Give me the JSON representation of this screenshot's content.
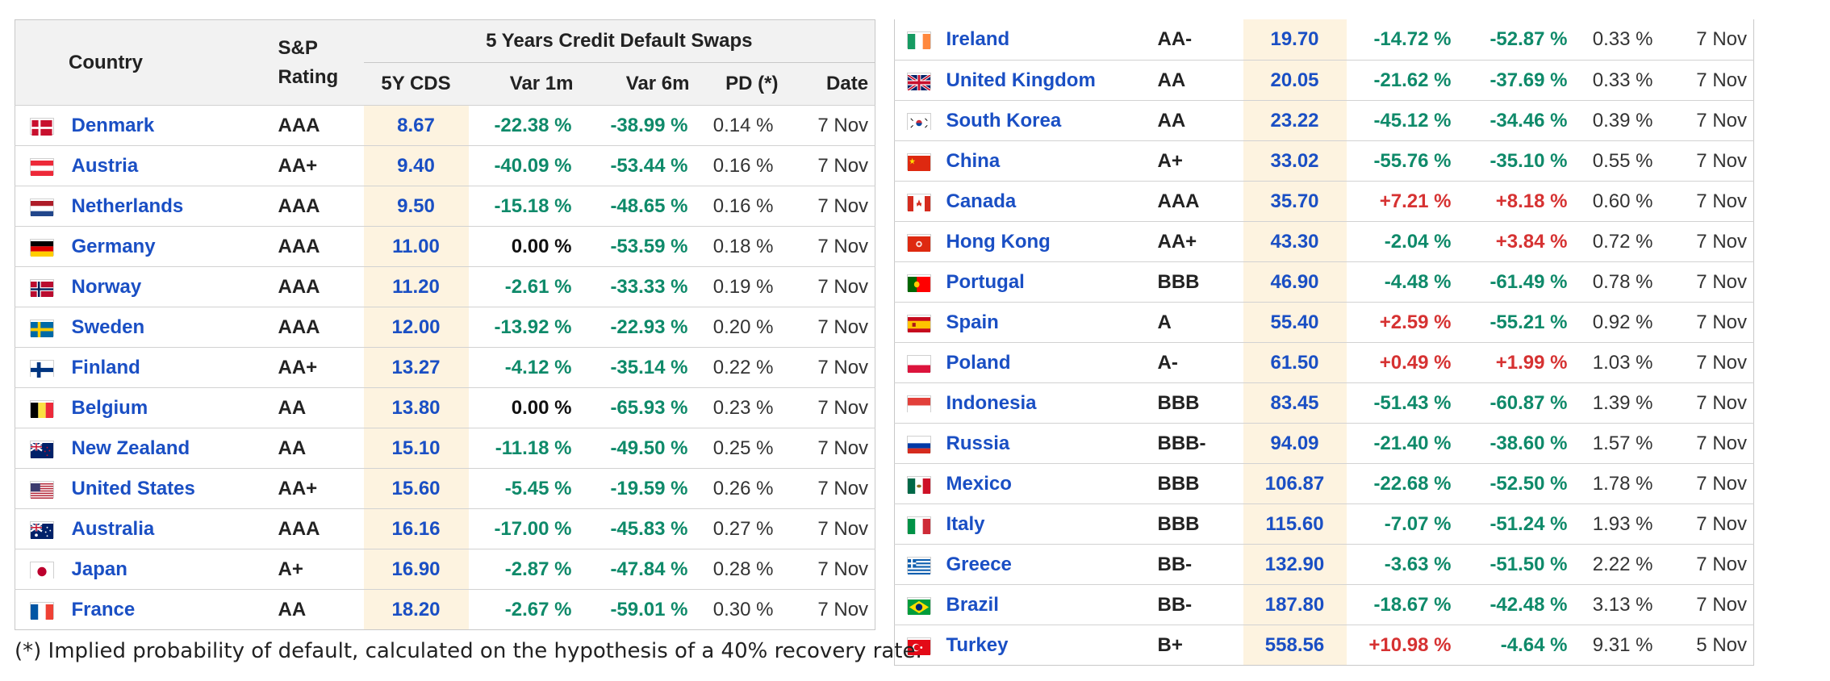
{
  "headers": {
    "country": "Country",
    "rating_line1": "S&P",
    "rating_line2": "Rating",
    "group": "5 Years Credit Default Swaps",
    "cds": "5Y CDS",
    "var1m": "Var 1m",
    "var6m": "Var 6m",
    "pd": "PD (*)",
    "date": "Date"
  },
  "footnote": "(*) Implied probability of default, calculated on the hypothesis of a 40% recovery rate.",
  "colors": {
    "negative": "#0f8a6a",
    "positive": "#d63232",
    "link": "#1a4fc4",
    "cds_bg": "#fdf3e0"
  },
  "left_rows": [
    {
      "flag": "denmark-flag-icon",
      "country": "Denmark",
      "rating": "AAA",
      "cds": "8.67",
      "var1m": "-22.38 %",
      "var6m": "-38.99 %",
      "pd": "0.14 %",
      "date": "7 Nov"
    },
    {
      "flag": "austria-flag-icon",
      "country": "Austria",
      "rating": "AA+",
      "cds": "9.40",
      "var1m": "-40.09 %",
      "var6m": "-53.44 %",
      "pd": "0.16 %",
      "date": "7 Nov"
    },
    {
      "flag": "netherlands-flag-icon",
      "country": "Netherlands",
      "rating": "AAA",
      "cds": "9.50",
      "var1m": "-15.18 %",
      "var6m": "-48.65 %",
      "pd": "0.16 %",
      "date": "7 Nov"
    },
    {
      "flag": "germany-flag-icon",
      "country": "Germany",
      "rating": "AAA",
      "cds": "11.00",
      "var1m": "0.00 %",
      "var6m": "-53.59 %",
      "pd": "0.18 %",
      "date": "7 Nov"
    },
    {
      "flag": "norway-flag-icon",
      "country": "Norway",
      "rating": "AAA",
      "cds": "11.20",
      "var1m": "-2.61 %",
      "var6m": "-33.33 %",
      "pd": "0.19 %",
      "date": "7 Nov"
    },
    {
      "flag": "sweden-flag-icon",
      "country": "Sweden",
      "rating": "AAA",
      "cds": "12.00",
      "var1m": "-13.92 %",
      "var6m": "-22.93 %",
      "pd": "0.20 %",
      "date": "7 Nov"
    },
    {
      "flag": "finland-flag-icon",
      "country": "Finland",
      "rating": "AA+",
      "cds": "13.27",
      "var1m": "-4.12 %",
      "var6m": "-35.14 %",
      "pd": "0.22 %",
      "date": "7 Nov"
    },
    {
      "flag": "belgium-flag-icon",
      "country": "Belgium",
      "rating": "AA",
      "cds": "13.80",
      "var1m": "0.00 %",
      "var6m": "-65.93 %",
      "pd": "0.23 %",
      "date": "7 Nov"
    },
    {
      "flag": "new-zealand-flag-icon",
      "country": "New Zealand",
      "rating": "AA",
      "cds": "15.10",
      "var1m": "-11.18 %",
      "var6m": "-49.50 %",
      "pd": "0.25 %",
      "date": "7 Nov"
    },
    {
      "flag": "united-states-flag-icon",
      "country": "United States",
      "rating": "AA+",
      "cds": "15.60",
      "var1m": "-5.45 %",
      "var6m": "-19.59 %",
      "pd": "0.26 %",
      "date": "7 Nov"
    },
    {
      "flag": "australia-flag-icon",
      "country": "Australia",
      "rating": "AAA",
      "cds": "16.16",
      "var1m": "-17.00 %",
      "var6m": "-45.83 %",
      "pd": "0.27 %",
      "date": "7 Nov"
    },
    {
      "flag": "japan-flag-icon",
      "country": "Japan",
      "rating": "A+",
      "cds": "16.90",
      "var1m": "-2.87 %",
      "var6m": "-47.84 %",
      "pd": "0.28 %",
      "date": "7 Nov"
    },
    {
      "flag": "france-flag-icon",
      "country": "France",
      "rating": "AA",
      "cds": "18.20",
      "var1m": "-2.67 %",
      "var6m": "-59.01 %",
      "pd": "0.30 %",
      "date": "7 Nov"
    }
  ],
  "right_rows": [
    {
      "flag": "ireland-flag-icon",
      "country": "Ireland",
      "rating": "AA-",
      "cds": "19.70",
      "var1m": "-14.72 %",
      "var6m": "-52.87 %",
      "pd": "0.33 %",
      "date": "7 Nov"
    },
    {
      "flag": "united-kingdom-flag-icon",
      "country": "United Kingdom",
      "rating": "AA",
      "cds": "20.05",
      "var1m": "-21.62 %",
      "var6m": "-37.69 %",
      "pd": "0.33 %",
      "date": "7 Nov"
    },
    {
      "flag": "south-korea-flag-icon",
      "country": "South Korea",
      "rating": "AA",
      "cds": "23.22",
      "var1m": "-45.12 %",
      "var6m": "-34.46 %",
      "pd": "0.39 %",
      "date": "7 Nov"
    },
    {
      "flag": "china-flag-icon",
      "country": "China",
      "rating": "A+",
      "cds": "33.02",
      "var1m": "-55.76 %",
      "var6m": "-35.10 %",
      "pd": "0.55 %",
      "date": "7 Nov"
    },
    {
      "flag": "canada-flag-icon",
      "country": "Canada",
      "rating": "AAA",
      "cds": "35.70",
      "var1m": "+7.21 %",
      "var6m": "+8.18 %",
      "pd": "0.60 %",
      "date": "7 Nov"
    },
    {
      "flag": "hong-kong-flag-icon",
      "country": "Hong Kong",
      "rating": "AA+",
      "cds": "43.30",
      "var1m": "-2.04 %",
      "var6m": "+3.84 %",
      "pd": "0.72 %",
      "date": "7 Nov"
    },
    {
      "flag": "portugal-flag-icon",
      "country": "Portugal",
      "rating": "BBB",
      "cds": "46.90",
      "var1m": "-4.48 %",
      "var6m": "-61.49 %",
      "pd": "0.78 %",
      "date": "7 Nov"
    },
    {
      "flag": "spain-flag-icon",
      "country": "Spain",
      "rating": "A",
      "cds": "55.40",
      "var1m": "+2.59 %",
      "var6m": "-55.21 %",
      "pd": "0.92 %",
      "date": "7 Nov"
    },
    {
      "flag": "poland-flag-icon",
      "country": "Poland",
      "rating": "A-",
      "cds": "61.50",
      "var1m": "+0.49 %",
      "var6m": "+1.99 %",
      "pd": "1.03 %",
      "date": "7 Nov"
    },
    {
      "flag": "indonesia-flag-icon",
      "country": "Indonesia",
      "rating": "BBB",
      "cds": "83.45",
      "var1m": "-51.43 %",
      "var6m": "-60.87 %",
      "pd": "1.39 %",
      "date": "7 Nov"
    },
    {
      "flag": "russia-flag-icon",
      "country": "Russia",
      "rating": "BBB-",
      "cds": "94.09",
      "var1m": "-21.40 %",
      "var6m": "-38.60 %",
      "pd": "1.57 %",
      "date": "7 Nov"
    },
    {
      "flag": "mexico-flag-icon",
      "country": "Mexico",
      "rating": "BBB",
      "cds": "106.87",
      "var1m": "-22.68 %",
      "var6m": "-52.50 %",
      "pd": "1.78 %",
      "date": "7 Nov"
    },
    {
      "flag": "italy-flag-icon",
      "country": "Italy",
      "rating": "BBB",
      "cds": "115.60",
      "var1m": "-7.07 %",
      "var6m": "-51.24 %",
      "pd": "1.93 %",
      "date": "7 Nov"
    },
    {
      "flag": "greece-flag-icon",
      "country": "Greece",
      "rating": "BB-",
      "cds": "132.90",
      "var1m": "-3.63 %",
      "var6m": "-51.50 %",
      "pd": "2.22 %",
      "date": "7 Nov"
    },
    {
      "flag": "brazil-flag-icon",
      "country": "Brazil",
      "rating": "BB-",
      "cds": "187.80",
      "var1m": "-18.67 %",
      "var6m": "-42.48 %",
      "pd": "3.13 %",
      "date": "7 Nov"
    },
    {
      "flag": "turkey-flag-icon",
      "country": "Turkey",
      "rating": "B+",
      "cds": "558.56",
      "var1m": "+10.98 %",
      "var6m": "-4.64 %",
      "pd": "9.31 %",
      "date": "5 Nov"
    }
  ]
}
